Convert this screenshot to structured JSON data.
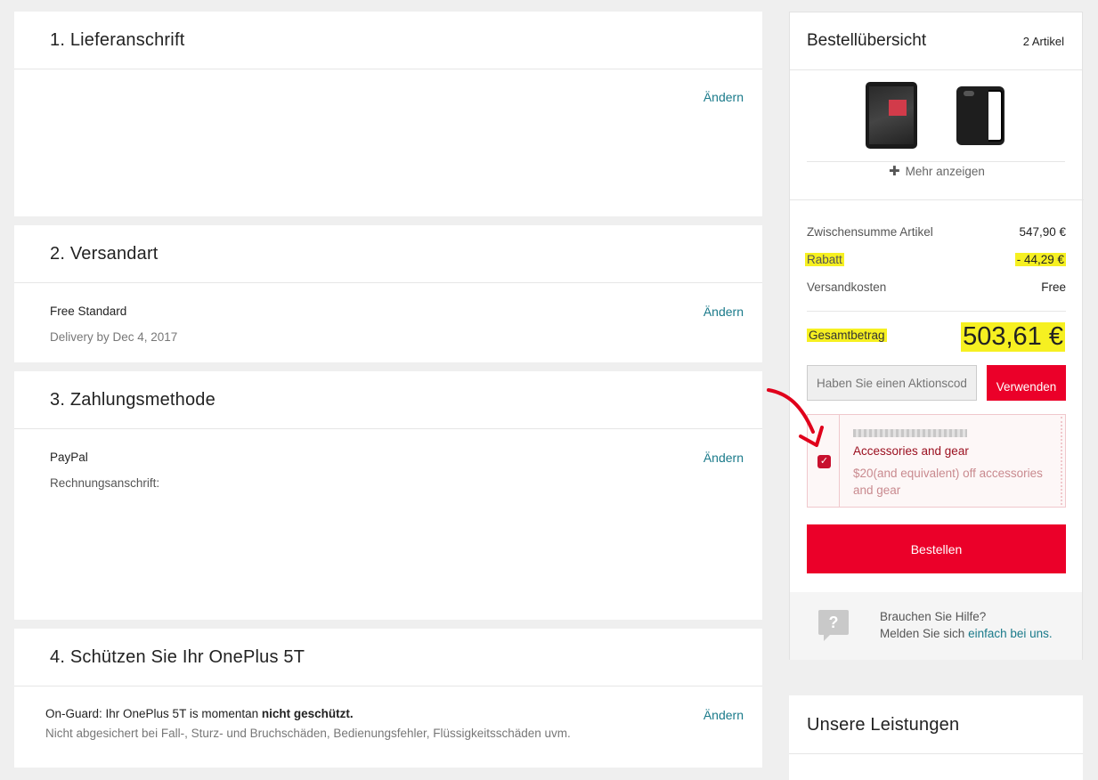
{
  "sections": {
    "s1": {
      "title": "1. Lieferanschrift",
      "change": "Ändern"
    },
    "s2": {
      "title": "2. Versandart",
      "change": "Ändern",
      "method": "Free Standard",
      "delivery": "Delivery by Dec 4, 2017"
    },
    "s3": {
      "title": "3. Zahlungsmethode",
      "change": "Ändern",
      "method": "PayPal",
      "billing": "Rechnungsanschrift:"
    },
    "s4": {
      "title": "4. Schützen Sie Ihr OnePlus 5T",
      "change": "Ändern",
      "status_prefix": "On-Guard: Ihr OnePlus 5T is momentan ",
      "status_bold": "nicht geschützt.",
      "note": "Nicht abgesichert bei Fall-, Sturz- und Bruchschäden, Bedienungsfehler, Flüssigkeitsschäden uvm."
    }
  },
  "summary": {
    "title": "Bestellübersicht",
    "count": "2 Artikel",
    "more": "Mehr anzeigen",
    "subtotal_label": "Zwischensumme Artikel",
    "subtotal_value": "547,90 €",
    "discount_label": "Rabatt",
    "discount_value": "- 44,29 €",
    "shipping_label": "Versandkosten",
    "shipping_value": "Free",
    "total_label": "Gesamtbetrag",
    "total_value": "503,61 €",
    "coupon_placeholder": "Haben Sie einen Aktionscode?",
    "apply": "Verwenden",
    "voucher_title": "Accessories and gear",
    "voucher_desc": "$20(and equivalent) off accessories and gear",
    "order": "Bestellen",
    "help_q": "Brauchen Sie Hilfe?",
    "help_prefix": "Melden Sie sich ",
    "help_link": "einfach bei uns."
  },
  "services": {
    "title": "Unsere Leistungen"
  },
  "colors": {
    "accent": "#eb0029",
    "link": "#1a7a8a",
    "highlight": "#f6f021",
    "annotation": "#e0001b"
  }
}
